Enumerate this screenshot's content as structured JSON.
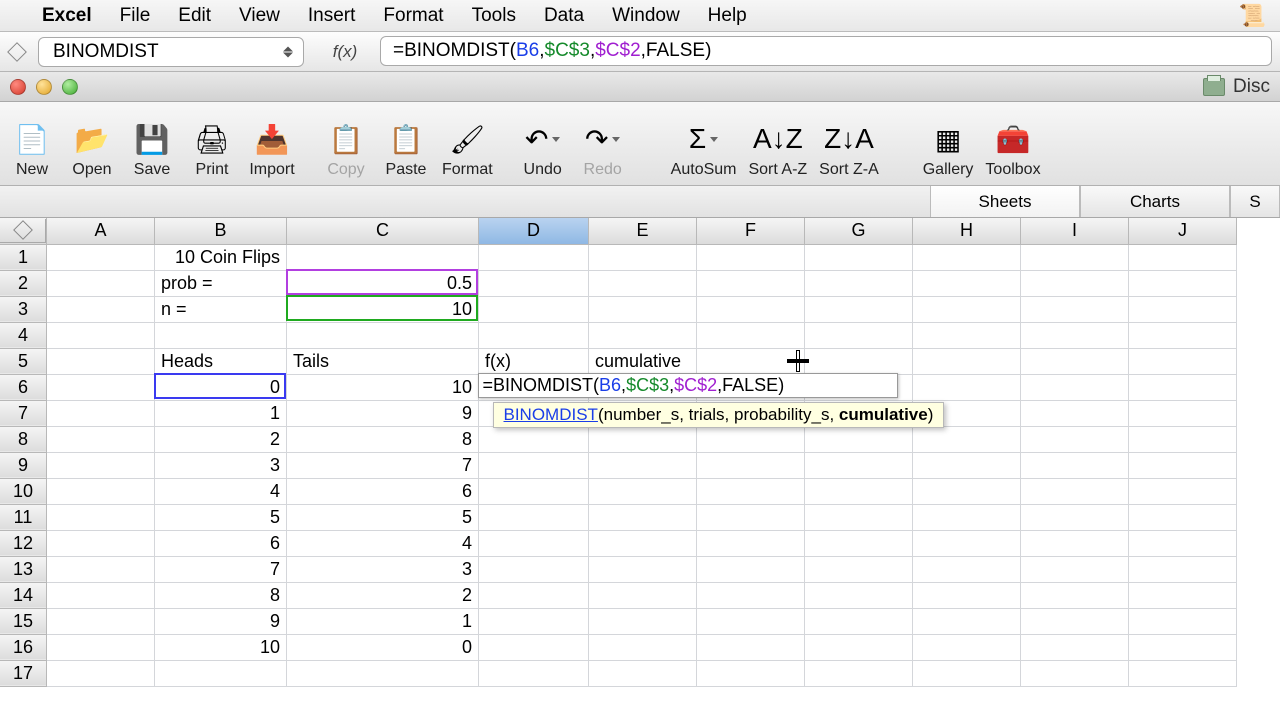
{
  "menubar": {
    "app": "Excel",
    "items": [
      "File",
      "Edit",
      "View",
      "Insert",
      "Format",
      "Tools",
      "Data",
      "Window",
      "Help"
    ]
  },
  "chrome": {
    "right_label": "Disc"
  },
  "formula_bar": {
    "name_box": "BINOMDIST",
    "fx_label": "f(x)",
    "formula": {
      "pre": "=BINOMDIST(",
      "ref_b6": "B6",
      "c1": ",",
      "ref_c3": "$C$3",
      "c2": ",",
      "ref_c2": "$C$2",
      "c3": ",",
      "false_kw": "FALSE",
      "close": ")"
    }
  },
  "toolbar": {
    "buttons": [
      {
        "name": "new",
        "label": "New",
        "icon": "📄"
      },
      {
        "name": "open",
        "label": "Open",
        "icon": "📂"
      },
      {
        "name": "save",
        "label": "Save",
        "icon": "💾"
      },
      {
        "name": "print",
        "label": "Print",
        "icon": "🖨"
      },
      {
        "name": "import",
        "label": "Import",
        "icon": "📥"
      },
      {
        "name": "copy",
        "label": "Copy",
        "icon": "📋",
        "dim": true
      },
      {
        "name": "paste",
        "label": "Paste",
        "icon": "📋"
      },
      {
        "name": "format",
        "label": "Format",
        "icon": "🖌"
      },
      {
        "name": "undo",
        "label": "Undo",
        "icon": "↶",
        "dd": true
      },
      {
        "name": "redo",
        "label": "Redo",
        "icon": "↷",
        "dim": true,
        "dd": true
      },
      {
        "name": "autosum",
        "label": "AutoSum",
        "icon": "Σ",
        "dd": true
      },
      {
        "name": "sortaz",
        "label": "Sort A-Z",
        "icon": "A↓Z"
      },
      {
        "name": "sortza",
        "label": "Sort Z-A",
        "icon": "Z↓A"
      },
      {
        "name": "gallery",
        "label": "Gallery",
        "icon": "▦"
      },
      {
        "name": "toolbox",
        "label": "Toolbox",
        "icon": "🧰"
      }
    ]
  },
  "tabs": {
    "sheets": "Sheets",
    "charts": "Charts",
    "extra": "S"
  },
  "sheet": {
    "col_labels": [
      "A",
      "B",
      "C",
      "D",
      "E",
      "F",
      "G",
      "H",
      "I",
      "J"
    ],
    "selected_col": "D",
    "row_count": 17,
    "cells": {
      "B1": "10 Coin Flips",
      "B2": "prob =",
      "C2": "0.5",
      "B3": "n =",
      "C3": "10",
      "B5": "Heads",
      "C5": "Tails",
      "D5": "f(x)",
      "E5": "cumulative",
      "B6": "0",
      "C6": "10",
      "B7": "1",
      "C7": "9",
      "B8": "2",
      "C8": "8",
      "B9": "3",
      "C9": "7",
      "B10": "4",
      "C10": "6",
      "B11": "5",
      "C11": "5",
      "B12": "6",
      "C12": "4",
      "B13": "7",
      "C13": "3",
      "B14": "8",
      "C14": "2",
      "B15": "9",
      "C15": "1",
      "B16": "10",
      "C16": "0"
    },
    "editing_formula": {
      "pre": "=BINOMDIST(",
      "ref_b6": "B6",
      "c1": ",",
      "ref_c3": "$C$3",
      "c2": ",",
      "ref_c2": "$C$2",
      "c3": ",",
      "false_kw": "FALSE",
      "close": ")"
    },
    "tooltip": {
      "fn": "BINOMDIST",
      "open": "(",
      "args": "number_s, trials, probability_s, ",
      "current": "cumulative",
      "close": ")"
    }
  }
}
